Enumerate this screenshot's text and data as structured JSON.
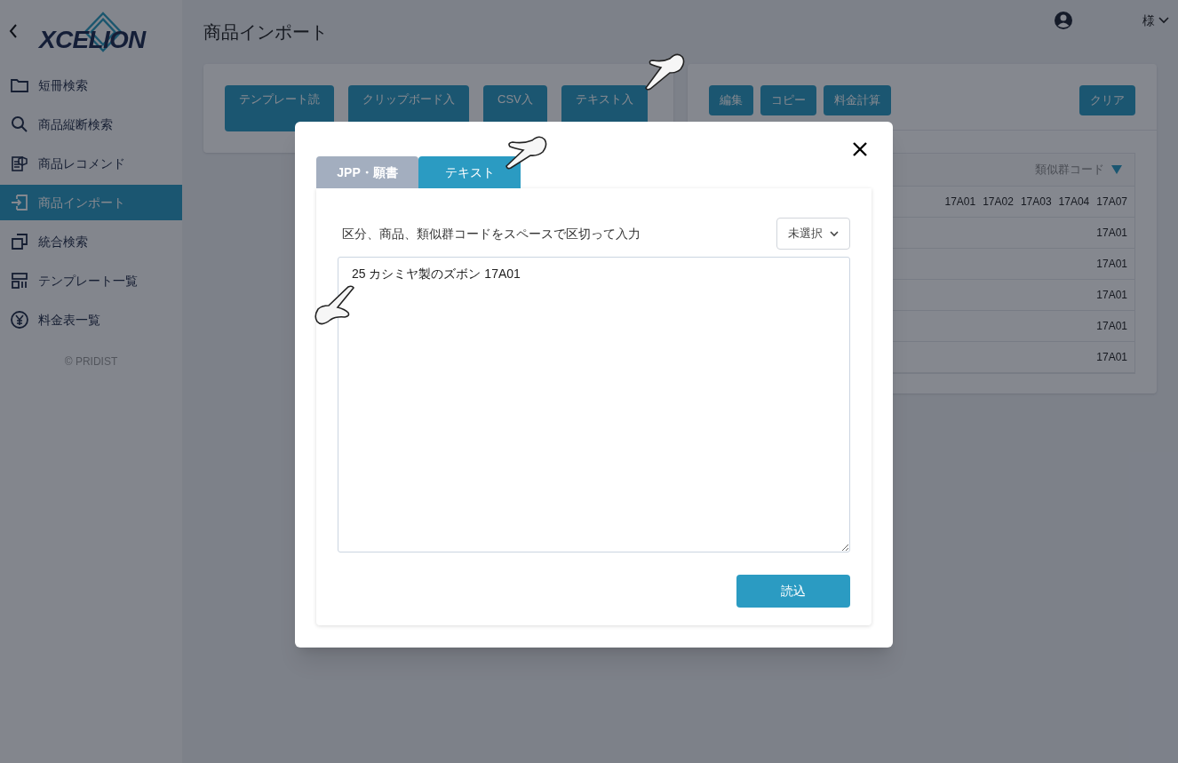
{
  "sidebar": {
    "logo": "XCELION",
    "items": [
      {
        "label": "短冊検索",
        "selected": false
      },
      {
        "label": "商品縦断検索",
        "selected": false
      },
      {
        "label": "商品レコメンド",
        "selected": false
      },
      {
        "label": "商品インポート",
        "selected": true
      },
      {
        "label": "統合検索",
        "selected": false
      },
      {
        "label": "テンプレート一覧",
        "selected": false
      },
      {
        "label": "料金表一覧",
        "selected": false
      }
    ],
    "footer": "© PRIDIST"
  },
  "header": {
    "title": "商品インポート",
    "user": "様"
  },
  "import_buttons": [
    "テンプレート読",
    "クリップボード入",
    "CSV入",
    "テキスト入"
  ],
  "result_panel": {
    "buttons": [
      "編集",
      "コピー",
      "料金計算"
    ],
    "clear_button": "クリア",
    "column": "類似群コード",
    "rows": [
      [
        "17A01",
        "17A02",
        "17A03",
        "17A04",
        "17A07"
      ],
      [
        "17A01"
      ],
      [
        "17A01"
      ],
      [
        "17A01"
      ],
      [
        "17A01"
      ],
      [
        "17A01"
      ]
    ]
  },
  "modal": {
    "tabs": [
      {
        "label": "JPP・願書",
        "selected": false
      },
      {
        "label": "テキスト",
        "selected": true
      }
    ],
    "instruction": "区分、商品、類似群コードをスペースで区切って入力",
    "select": "未選択",
    "textarea": "25 カシミヤ製のズボン 17A01",
    "submit": "読込"
  }
}
